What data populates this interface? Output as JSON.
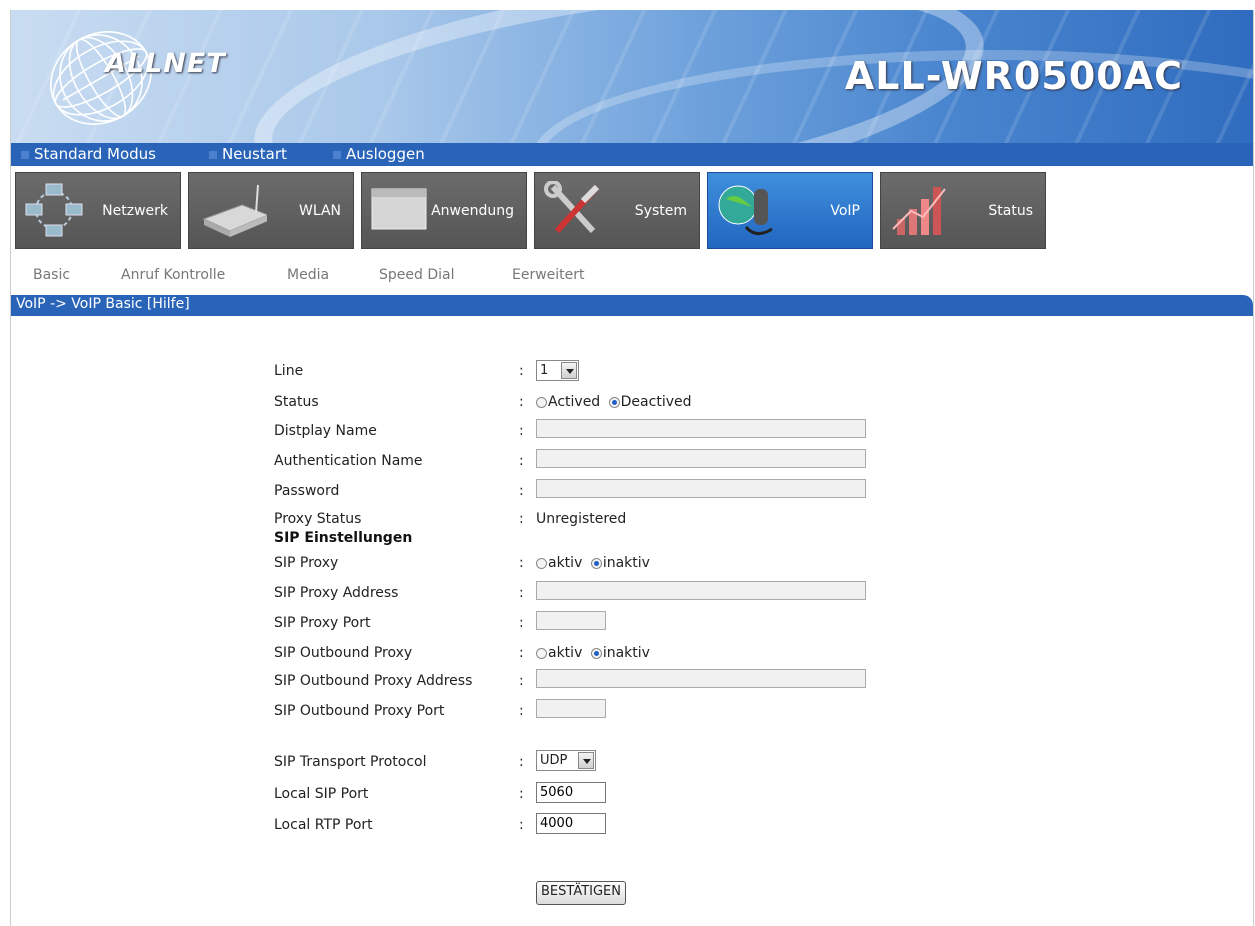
{
  "header": {
    "brand": "ALLNET",
    "model": "ALL-WR0500AC"
  },
  "menubar": {
    "items": [
      "Standard Modus",
      "Neustart",
      "Ausloggen"
    ]
  },
  "nav": {
    "tiles": [
      {
        "label": "Netzwerk",
        "icon": "network-icon"
      },
      {
        "label": "WLAN",
        "icon": "router-icon"
      },
      {
        "label": "Anwendung",
        "icon": "application-icon"
      },
      {
        "label": "System",
        "icon": "tools-icon"
      },
      {
        "label": "VoIP",
        "icon": "voip-phone-icon",
        "active": true
      },
      {
        "label": "Status",
        "icon": "status-chart-icon"
      }
    ],
    "active_color": "#2a6ccc"
  },
  "subnav": {
    "items": [
      "Basic",
      "Anruf Kontrolle",
      "Media",
      "Speed Dial",
      "Eerweitert"
    ]
  },
  "breadcrumb": {
    "text": "VoIP -> VoIP Basic [Hilfe]"
  },
  "form": {
    "line": {
      "label": "Line",
      "value": "1"
    },
    "status": {
      "label": "Status",
      "options": [
        "Actived",
        "Deactived"
      ],
      "selected": "Deactived"
    },
    "display_name": {
      "label": "Distplay Name",
      "value": ""
    },
    "auth_name": {
      "label": "Authentication Name",
      "value": ""
    },
    "password": {
      "label": "Password",
      "value": ""
    },
    "proxy_status": {
      "label": "Proxy Status",
      "value": "Unregistered"
    },
    "sip_section": "SIP Einstellungen",
    "sip_proxy": {
      "label": "SIP Proxy",
      "options": [
        "aktiv",
        "inaktiv"
      ],
      "selected": "inaktiv"
    },
    "sip_proxy_address": {
      "label": "SIP Proxy Address",
      "value": ""
    },
    "sip_proxy_port": {
      "label": "SIP Proxy Port",
      "value": ""
    },
    "sip_outbound_proxy": {
      "label": "SIP Outbound Proxy",
      "options": [
        "aktiv",
        "inaktiv"
      ],
      "selected": "inaktiv"
    },
    "sip_outbound_proxy_address": {
      "label": "SIP Outbound Proxy Address",
      "value": ""
    },
    "sip_outbound_proxy_port": {
      "label": "SIP Outbound Proxy Port",
      "value": ""
    },
    "sip_transport": {
      "label": "SIP Transport Protocol",
      "value": "UDP"
    },
    "local_sip_port": {
      "label": "Local SIP Port",
      "value": "5060"
    },
    "local_rtp_port": {
      "label": "Local RTP Port",
      "value": "4000"
    },
    "colon": ":",
    "submit_label": "BESTÄTIGEN"
  }
}
